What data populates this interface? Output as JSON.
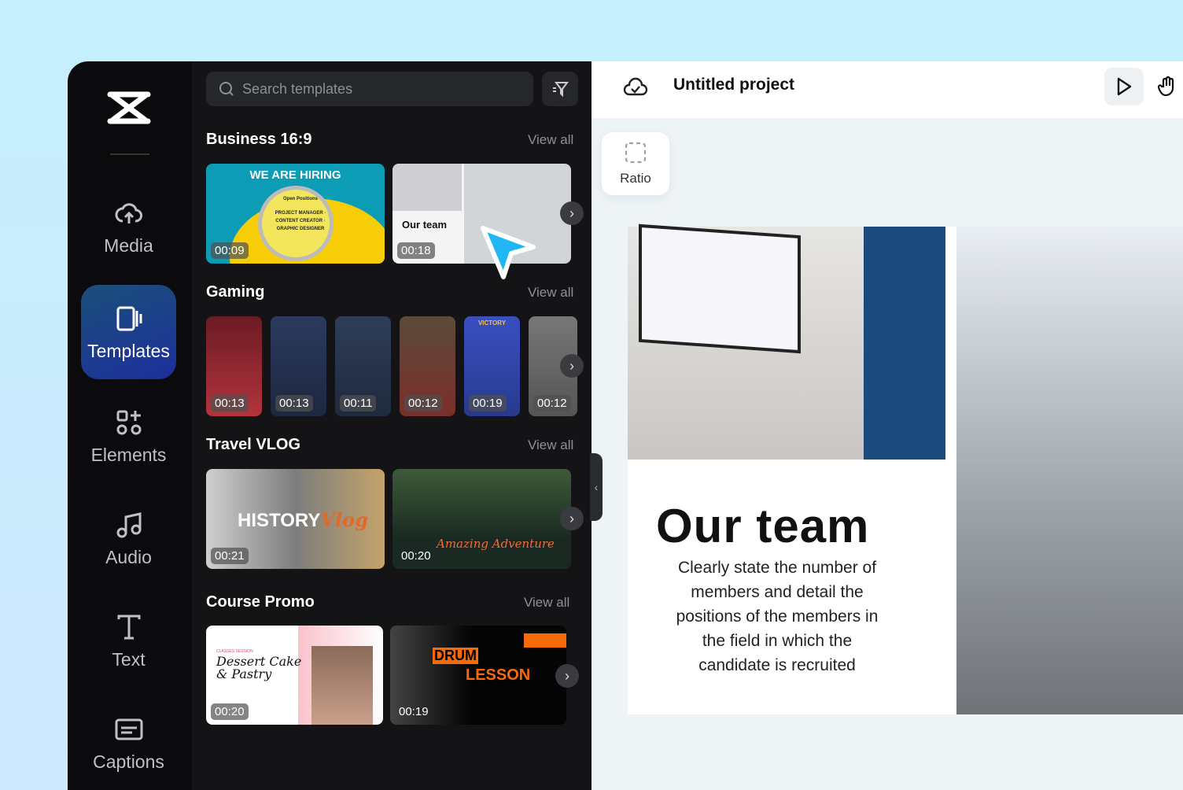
{
  "sidebar": {
    "items": [
      {
        "label": "Media",
        "icon": "cloud-upload-icon"
      },
      {
        "label": "Templates",
        "icon": "templates-icon",
        "active": true
      },
      {
        "label": "Elements",
        "icon": "elements-icon"
      },
      {
        "label": "Audio",
        "icon": "music-note-icon"
      },
      {
        "label": "Text",
        "icon": "text-icon"
      },
      {
        "label": "Captions",
        "icon": "captions-icon"
      }
    ]
  },
  "panel": {
    "search_placeholder": "Search templates",
    "view_all": "View all",
    "sections": [
      {
        "title": "Business 16:9",
        "templates": [
          {
            "text": "WE ARE HIRING",
            "sub": "Open Positions",
            "lines": "PROJECT MANAGER · CONTENT CREATOR · GRAPHIC DESIGNER",
            "duration": "00:09"
          },
          {
            "text": "Our team",
            "duration": "00:18"
          }
        ]
      },
      {
        "title": "Gaming",
        "templates": [
          {
            "duration": "00:13"
          },
          {
            "duration": "00:13"
          },
          {
            "duration": "00:11"
          },
          {
            "duration": "00:12"
          },
          {
            "text": "VICTORY",
            "duration": "00:19"
          },
          {
            "duration": "00:12"
          }
        ]
      },
      {
        "title": "Travel VLOG",
        "templates": [
          {
            "text": "HISTORY",
            "accent": "Vlog",
            "duration": "00:21"
          },
          {
            "text": "Amazing Adventure",
            "duration": "00:20"
          }
        ]
      },
      {
        "title": "Course Promo",
        "templates": [
          {
            "sub": "CLASSES SESSION",
            "text": "Dessert Cake & Pastry",
            "duration": "00:20"
          },
          {
            "text": "DRUM",
            "accent": "LESSON",
            "duration": "00:19"
          }
        ]
      }
    ]
  },
  "header": {
    "title": "Untitled project",
    "icon": "cloud-check-icon"
  },
  "canvas": {
    "ratio_label": "Ratio",
    "preview": {
      "title": "Our team",
      "description": "Clearly state the number of members and detail the positions of the members in the field in which the candidate is recruited"
    }
  },
  "colors": {
    "accent": "#1c2f9c",
    "cursor": "#1fb8f5"
  }
}
